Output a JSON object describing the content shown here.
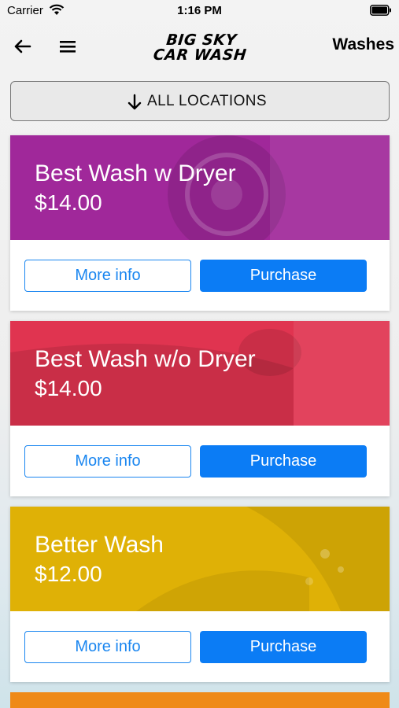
{
  "status_bar": {
    "carrier": "Carrier",
    "time": "1:16 PM"
  },
  "nav": {
    "logo_line1": "BIG SKY",
    "logo_line2": "CAR WASH",
    "title": "Washes"
  },
  "location_filter": {
    "label": "ALL LOCATIONS"
  },
  "cards": [
    {
      "name": "Best Wash w Dryer",
      "price": "$14.00",
      "color": "#a0289a",
      "more_label": "More info",
      "buy_label": "Purchase"
    },
    {
      "name": "Best Wash w/o Dryer",
      "price": "$14.00",
      "color": "#e03450",
      "more_label": "More info",
      "buy_label": "Purchase"
    },
    {
      "name": "Better Wash",
      "price": "$12.00",
      "color": "#dfb106",
      "more_label": "More info",
      "buy_label": "Purchase"
    }
  ],
  "colors": {
    "accent": "#0b7cf5",
    "next_card": "#ef8a18"
  },
  "icons": {
    "back": "back-arrow-icon",
    "menu": "hamburger-menu-icon",
    "filter": "down-arrow-icon",
    "wifi": "wifi-icon",
    "battery": "battery-icon"
  }
}
